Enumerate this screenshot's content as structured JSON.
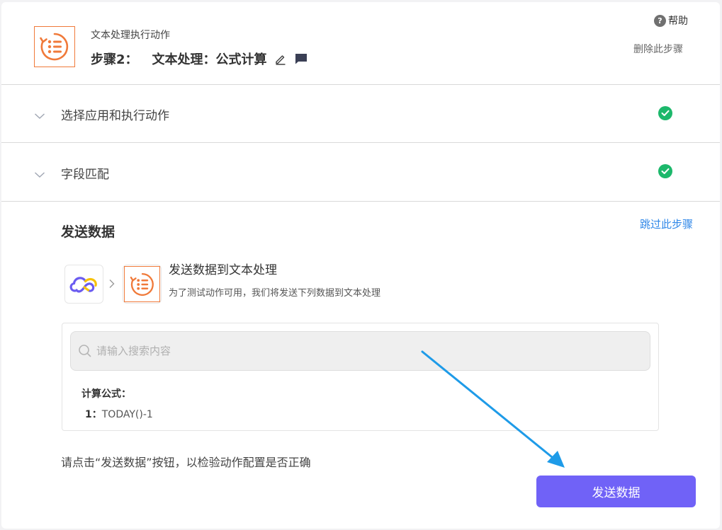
{
  "header": {
    "subtitle": "文本处理执行动作",
    "step_label": "步骤2：",
    "step_title": "文本处理：公式计算",
    "help_label": "帮助",
    "delete_label": "删除此步骤"
  },
  "sections": [
    {
      "label": "选择应用和执行动作",
      "status": "done"
    },
    {
      "label": "字段匹配",
      "status": "done"
    }
  ],
  "send": {
    "title": "发送数据",
    "skip_label": "跳过此步骤",
    "flow_title": "发送数据到文本处理",
    "flow_desc": "为了测试动作可用，我们将发送下列数据到文本处理",
    "search_placeholder": "请输入搜索内容",
    "field_label": "计算公式：",
    "field_index": "1：",
    "field_value": "TODAY()-1",
    "hint": "请点击“发送数据”按钮，以检验动作配置是否正确",
    "button_label": "发送数据"
  },
  "colors": {
    "accent": "#7062f7",
    "success": "#1cb86b",
    "link": "#2f87e8",
    "app_orange": "#f07a3a",
    "annotation_arrow": "#1e9be8"
  },
  "icons": {
    "step_app": "text-processing-icon",
    "source_app": "cloud-infinity-logo-icon",
    "edit": "pencil-icon",
    "comment": "comment-icon",
    "help": "question-circle-icon",
    "search": "search-icon",
    "chevron": "chevron-down-icon",
    "check": "check-circle-icon"
  }
}
